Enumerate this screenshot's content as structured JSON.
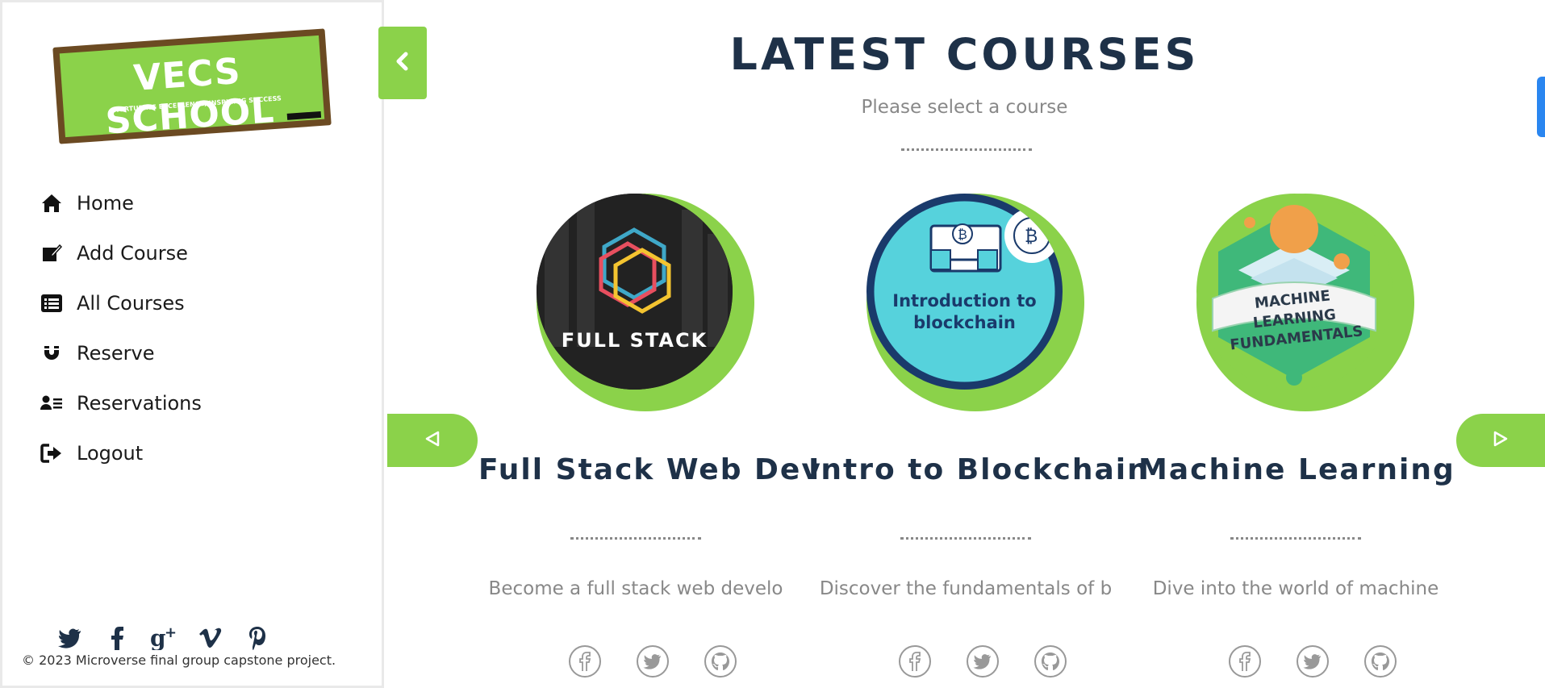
{
  "brand": {
    "logo_title": "VECS SCHOOL",
    "logo_tagline": "NURTURING EXCELLENCE, INSPIRING SUCCESS",
    "accent": "#8bd24a",
    "heading_color": "#1e3148"
  },
  "sidebar": {
    "items": [
      {
        "label": "Home",
        "icon": "home-icon"
      },
      {
        "label": "Add Course",
        "icon": "edit-icon"
      },
      {
        "label": "All Courses",
        "icon": "list-icon"
      },
      {
        "label": "Reserve",
        "icon": "magnet-icon"
      },
      {
        "label": "Reservations",
        "icon": "user-list-icon"
      },
      {
        "label": "Logout",
        "icon": "logout-icon"
      }
    ],
    "social": [
      "twitter-icon",
      "facebook-icon",
      "google-plus-icon",
      "vimeo-icon",
      "pinterest-icon"
    ],
    "copyright": "2023 Microverse final group capstone project."
  },
  "main": {
    "heading": "LATEST COURSES",
    "subheading": "Please select a course",
    "courses": [
      {
        "title": "Full Stack Web Dev",
        "description": "Become a full stack web develo",
        "image_text": "FULL STACK"
      },
      {
        "title": "Intro to Blockchain",
        "description": "Discover the fundamentals of b",
        "image_text": "Introduction to blockchain"
      },
      {
        "title": "Machine Learning",
        "description": "Dive into the world of machine",
        "image_text": "MACHINE LEARNING FUNDAMENTALS"
      }
    ]
  }
}
